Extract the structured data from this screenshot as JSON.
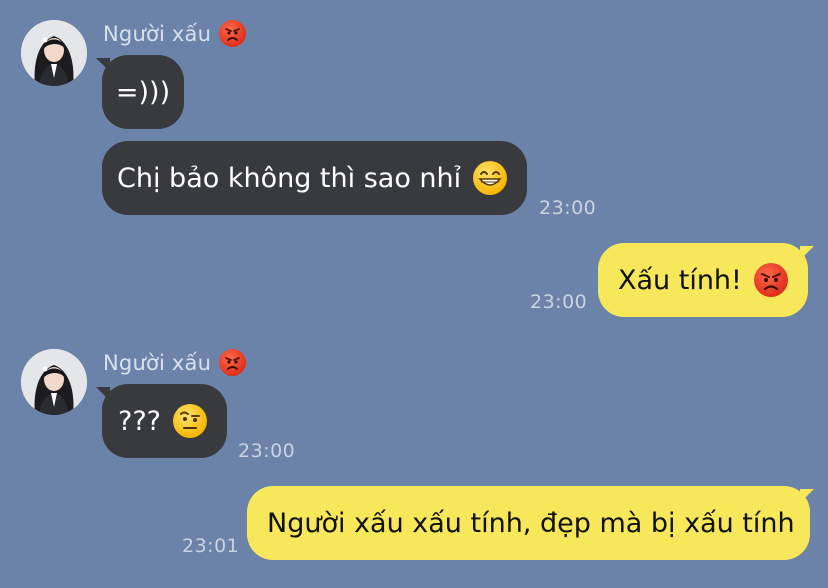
{
  "messages": [
    {
      "sender": "Người xấu",
      "sender_emoji": "angry-face-icon",
      "bubbles": [
        "=)))",
        "Chị bảo không thì sao nhỉ"
      ],
      "bubble_emojis": [
        "",
        "grinning-face-icon"
      ],
      "time": "23:00",
      "side": "left"
    },
    {
      "text": "Xấu tính!",
      "emoji": "angry-face-icon",
      "time": "23:00",
      "side": "right"
    },
    {
      "sender": "Người xấu",
      "sender_emoji": "angry-face-icon",
      "bubbles": [
        "???"
      ],
      "bubble_emojis": [
        "raised-eyebrow-face-icon"
      ],
      "time": "23:00",
      "side": "left"
    },
    {
      "text": "Người xấu xấu tính, đẹp mà bị xấu tính",
      "emoji": "",
      "time": "23:01",
      "side": "right"
    }
  ],
  "colors": {
    "background": "#6b83a8",
    "incoming_bubble": "#393a3d",
    "outgoing_bubble": "#f7e75a"
  }
}
